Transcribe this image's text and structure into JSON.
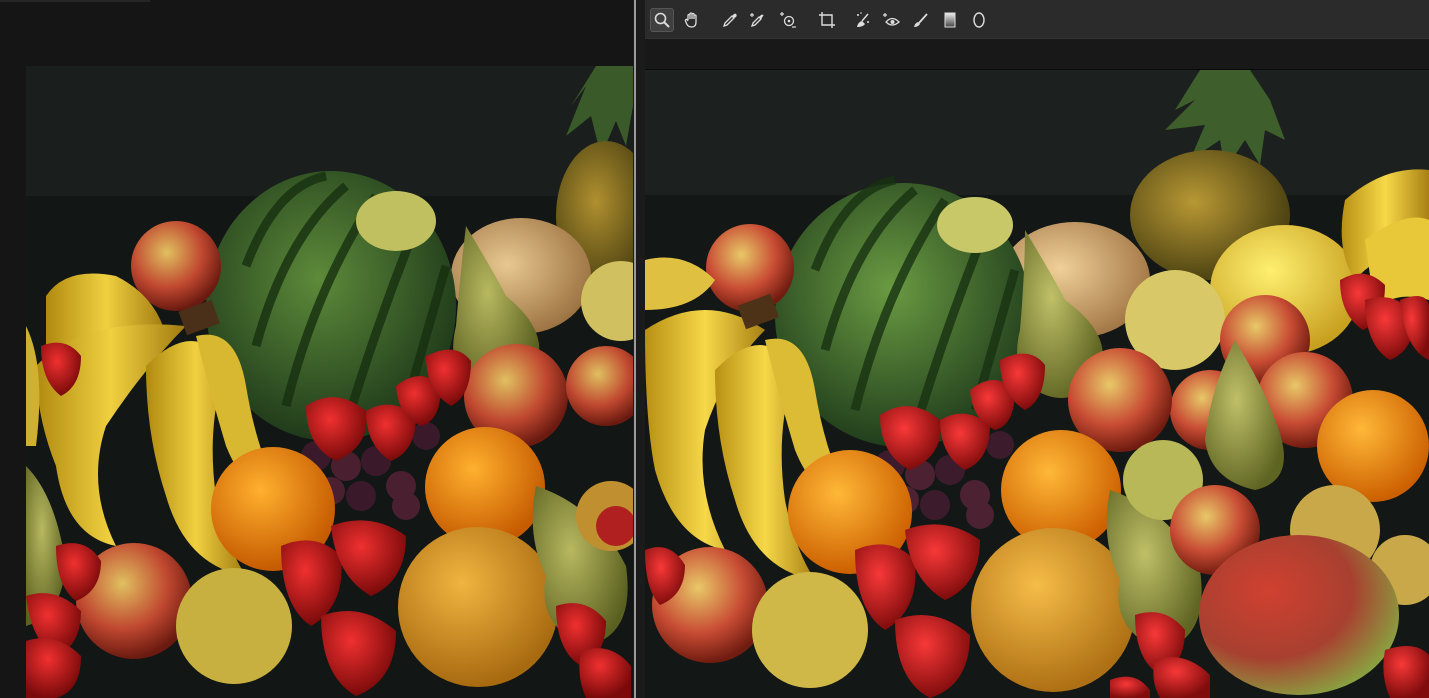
{
  "left_pane": {
    "image_name": "fruit-still-life-before"
  },
  "right_pane": {
    "image_name": "fruit-still-life-after",
    "toolbar": {
      "tools": [
        {
          "icon": "zoom-icon",
          "active": true
        },
        {
          "icon": "hand-pan-icon",
          "active": false
        },
        {
          "icon": "eyedropper-icon",
          "active": false
        },
        {
          "icon": "color-sampler-icon",
          "active": false
        },
        {
          "icon": "targeted-adjust-icon",
          "active": false
        },
        {
          "icon": "crop-icon",
          "active": false
        },
        {
          "icon": "spot-removal-icon",
          "active": false
        },
        {
          "icon": "red-eye-icon",
          "active": false
        },
        {
          "icon": "adjustment-brush-icon",
          "active": false
        },
        {
          "icon": "graduated-filter-icon",
          "active": false
        },
        {
          "icon": "radial-filter-icon",
          "active": false
        }
      ]
    }
  },
  "colors": {
    "background": "#141414",
    "toolbar": "#2b2b2b",
    "divider": "#9a9a9a",
    "photo_backdrop": "#101312"
  }
}
